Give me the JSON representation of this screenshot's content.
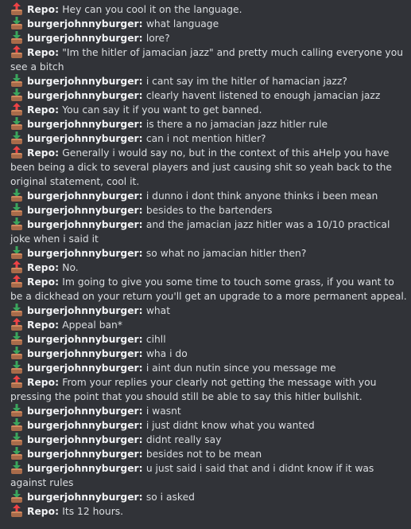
{
  "colors": {
    "background": "#313338",
    "text": "#dbdee1",
    "author": "#f2f3f5",
    "receive_arrow": "#3ba55d",
    "send_arrow": "#ed4245",
    "tray": "#a86b4a"
  },
  "messages": [
    {
      "direction": "out",
      "icon": "outbox-icon",
      "author": "Repo",
      "text": "Hey can you cool it on the language."
    },
    {
      "direction": "in",
      "icon": "inbox-icon",
      "author": "burgerjohnnyburger",
      "text": "what language"
    },
    {
      "direction": "in",
      "icon": "inbox-icon",
      "author": "burgerjohnnyburger",
      "text": "lore?"
    },
    {
      "direction": "out",
      "icon": "outbox-icon",
      "author": "Repo",
      "text": "\"Im the hitler of jamacian jazz\" and pretty much calling everyone you see a bitch"
    },
    {
      "direction": "in",
      "icon": "inbox-icon",
      "author": "burgerjohnnyburger",
      "text": "i cant say im the hitler of hamacian jazz?"
    },
    {
      "direction": "in",
      "icon": "inbox-icon",
      "author": "burgerjohnnyburger",
      "text": "clearly havent listened to enough jamacian jazz"
    },
    {
      "direction": "out",
      "icon": "outbox-icon",
      "author": "Repo",
      "text": "You can say it if you want to get banned."
    },
    {
      "direction": "in",
      "icon": "inbox-icon",
      "author": "burgerjohnnyburger",
      "text": "is there a no jamacian jazz hitler rule"
    },
    {
      "direction": "in",
      "icon": "inbox-icon",
      "author": "burgerjohnnyburger",
      "text": "can i not mention hitler?"
    },
    {
      "direction": "out",
      "icon": "outbox-icon",
      "author": "Repo",
      "text": "Generally i would say no, but in the context of this aHelp you have been being a dick to several players and just causing shit so yeah back to the original statement, cool it."
    },
    {
      "direction": "in",
      "icon": "inbox-icon",
      "author": "burgerjohnnyburger",
      "text": "i dunno i dont think anyone thinks i been mean"
    },
    {
      "direction": "in",
      "icon": "inbox-icon",
      "author": "burgerjohnnyburger",
      "text": "besides to the bartenders"
    },
    {
      "direction": "in",
      "icon": "inbox-icon",
      "author": "burgerjohnnyburger",
      "text": "and the jamacian jazz hitler was a 10/10 practical joke when i said it"
    },
    {
      "direction": "in",
      "icon": "inbox-icon",
      "author": "burgerjohnnyburger",
      "text": "so what no jamacian hitler then?"
    },
    {
      "direction": "out",
      "icon": "outbox-icon",
      "author": "Repo",
      "text": "No."
    },
    {
      "direction": "out",
      "icon": "outbox-icon",
      "author": "Repo",
      "text": "Im going to give you some time to touch some grass, if you want to be a dickhead on your return you'll get an upgrade to a more permanent appeal."
    },
    {
      "direction": "in",
      "icon": "inbox-icon",
      "author": "burgerjohnnyburger",
      "text": "what"
    },
    {
      "direction": "out",
      "icon": "outbox-icon",
      "author": "Repo",
      "text": "Appeal ban*"
    },
    {
      "direction": "in",
      "icon": "inbox-icon",
      "author": "burgerjohnnyburger",
      "text": "cihll"
    },
    {
      "direction": "in",
      "icon": "inbox-icon",
      "author": "burgerjohnnyburger",
      "text": "wha i do"
    },
    {
      "direction": "in",
      "icon": "inbox-icon",
      "author": "burgerjohnnyburger",
      "text": "i aint dun nutin since you message me"
    },
    {
      "direction": "out",
      "icon": "outbox-icon",
      "author": "Repo",
      "text": "From your replies your clearly not getting the message with you pressing the point that you should still be able to say this hitler bullshit."
    },
    {
      "direction": "in",
      "icon": "inbox-icon",
      "author": "burgerjohnnyburger",
      "text": "i wasnt"
    },
    {
      "direction": "in",
      "icon": "inbox-icon",
      "author": "burgerjohnnyburger",
      "text": "i just didnt know what you wanted"
    },
    {
      "direction": "in",
      "icon": "inbox-icon",
      "author": "burgerjohnnyburger",
      "text": "didnt really say"
    },
    {
      "direction": "in",
      "icon": "inbox-icon",
      "author": "burgerjohnnyburger",
      "text": "besides not to be mean"
    },
    {
      "direction": "in",
      "icon": "inbox-icon",
      "author": "burgerjohnnyburger",
      "text": "u just said i said that and i didnt know if it was against rules"
    },
    {
      "direction": "in",
      "icon": "inbox-icon",
      "author": "burgerjohnnyburger",
      "text": "so i asked"
    },
    {
      "direction": "out",
      "icon": "outbox-icon",
      "author": "Repo",
      "text": "Its 12 hours."
    }
  ]
}
